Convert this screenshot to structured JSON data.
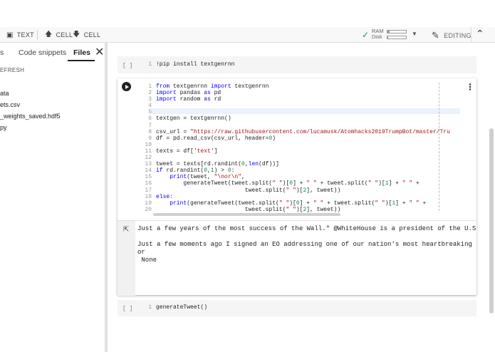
{
  "toolbar": {
    "text_btn": "TEXT",
    "cell_up_btn": "CELL",
    "cell_down_btn": "CELL",
    "ram_label": "RAM",
    "disk_label": "Disk",
    "ram_usage": 0.1,
    "disk_usage": 0.05,
    "editing_label": "EDITING"
  },
  "sidebar": {
    "tabs": [
      "s",
      "Code snippets",
      "Files"
    ],
    "active_tab": "Files",
    "refresh_label": "EFRESH",
    "files": [
      "ata",
      "ets.csv",
      "_weights_saved.hdf5",
      "py"
    ]
  },
  "cells": {
    "c1": {
      "prompt": "[ ]",
      "lines": [
        {
          "n": "1",
          "text": "!pip install textgenrnn"
        }
      ]
    },
    "c2": {
      "lines": [
        {
          "n": "1"
        },
        {
          "n": "2"
        },
        {
          "n": "3"
        },
        {
          "n": "4"
        },
        {
          "n": "5"
        },
        {
          "n": "6"
        },
        {
          "n": "7"
        },
        {
          "n": "8"
        },
        {
          "n": "9"
        },
        {
          "n": "10"
        },
        {
          "n": "11"
        },
        {
          "n": "12"
        },
        {
          "n": "13"
        },
        {
          "n": "14"
        },
        {
          "n": "15"
        },
        {
          "n": "16"
        },
        {
          "n": "17"
        },
        {
          "n": "18"
        },
        {
          "n": "19"
        },
        {
          "n": "20"
        }
      ],
      "code": {
        "l1_a": "from",
        "l1_b": " textgenrnn ",
        "l1_c": "import",
        "l1_d": " textgenrnn",
        "l2_a": "import",
        "l2_b": " pandas ",
        "l2_c": "as",
        "l2_d": " pd",
        "l3_a": "import",
        "l3_b": " random ",
        "l3_c": "as",
        "l3_d": " rd",
        "l6": "textgen = textgenrnn()",
        "l8_a": "csv_url = ",
        "l8_b": "\"https://raw.githubusercontent.com/lucamusk/Atomhacks2019TrumpBot/master/Tru",
        "l9_a": "df = pd.read_csv(csv_url, header=",
        "l9_b": "0",
        "l9_c": ")",
        "l11_a": "texts = df[",
        "l11_b": "'text'",
        "l11_c": "]",
        "l13_a": "tweet = texts[rd.randint(",
        "l13_b": "0",
        "l13_c": ",",
        "l13_d": "len",
        "l13_e": "(df))]",
        "l14_a": "if",
        "l14_b": " rd.randint(",
        "l14_c": "0",
        "l14_d": ",",
        "l14_e": "1",
        "l14_f": ") > ",
        "l14_g": "0",
        "l14_h": ":",
        "l15_a": "    ",
        "l15_b": "print",
        "l15_c": "(tweet, ",
        "l15_d": "\"\\nor\\n\"",
        "l15_e": ",",
        "l16_a": "        generateTweet(tweet.split(",
        "l16_b": "\" \"",
        "l16_c": ")[",
        "l16_d": "0",
        "l16_e": "] + ",
        "l16_f": "\" \"",
        "l16_g": " + tweet.split(",
        "l16_h": "\" \"",
        "l16_i": ")[",
        "l16_j": "1",
        "l16_k": "] + ",
        "l16_l": "\" \"",
        "l16_m": " +",
        "l17_a": "                          tweet.split(",
        "l17_b": "\" \"",
        "l17_c": ")[",
        "l17_d": "2",
        "l17_e": "], tweet))",
        "l18_a": "else",
        "l18_b": ":",
        "l19_a": "    ",
        "l19_b": "print",
        "l19_c": "(generateTweet(tweet.split(",
        "l19_d": "\" \"",
        "l19_e": ")[",
        "l19_f": "0",
        "l19_g": "] + ",
        "l19_h": "\" \"",
        "l19_i": " + tweet.split(",
        "l19_j": "\" \"",
        "l19_k": ")[",
        "l19_l": "1",
        "l19_m": "] + ",
        "l19_n": "\" \"",
        "l19_o": " +",
        "l20_a": "                          tweet.split(",
        "l20_b": "\" \"",
        "l20_c": ")[",
        "l20_d": "2",
        "l20_e": "], tweet))"
      },
      "output": "Just a few years of the most success of the Wall.\" @WhiteHouse is a president of the U.S\n\nJust a few moments ago I signed an EO addressing one of our nation's most heartbreaking\nor\n None"
    },
    "c3": {
      "prompt": "[ ]",
      "lines": [
        {
          "n": "1",
          "text": "generateTweet()"
        }
      ]
    }
  }
}
